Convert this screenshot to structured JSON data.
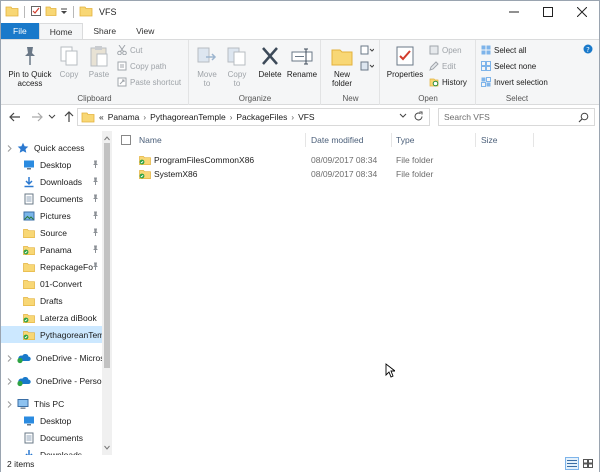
{
  "window": {
    "title": "VFS"
  },
  "ribbon": {
    "tabs": [
      {
        "label": "File"
      },
      {
        "label": "Home"
      },
      {
        "label": "Share"
      },
      {
        "label": "View"
      }
    ],
    "clipboard": {
      "label": "Clipboard",
      "pin": "Pin to Quick\naccess",
      "copy": "Copy",
      "paste": "Paste",
      "cut": "Cut",
      "copy_path": "Copy path",
      "paste_shortcut": "Paste shortcut"
    },
    "organize": {
      "label": "Organize",
      "move_to": "Move\nto",
      "copy_to": "Copy\nto",
      "delete": "Delete",
      "rename": "Rename"
    },
    "new": {
      "label": "New",
      "new_folder": "New\nfolder"
    },
    "open": {
      "label": "Open",
      "properties": "Properties",
      "open": "Open",
      "edit": "Edit",
      "history": "History"
    },
    "select": {
      "label": "Select",
      "select_all": "Select all",
      "select_none": "Select none",
      "invert": "Invert selection"
    }
  },
  "address": {
    "prefix": "«",
    "crumbs": [
      "Panama",
      "PythagoreanTemple",
      "PackageFiles",
      "VFS"
    ],
    "search_placeholder": "Search VFS"
  },
  "nav_pane": {
    "items": [
      {
        "label": "Quick access",
        "icon": "star-icon",
        "pinned": false
      },
      {
        "label": "Desktop",
        "icon": "desktop-icon",
        "pinned": true
      },
      {
        "label": "Downloads",
        "icon": "downloads-icon",
        "pinned": true
      },
      {
        "label": "Documents",
        "icon": "documents-icon",
        "pinned": true
      },
      {
        "label": "Pictures",
        "icon": "pictures-icon",
        "pinned": true
      },
      {
        "label": "Source",
        "icon": "folder-icon",
        "pinned": true
      },
      {
        "label": "Panama",
        "icon": "folder-green-icon",
        "pinned": true
      },
      {
        "label": "RepackageFo",
        "icon": "folder-icon",
        "pinned": true
      },
      {
        "label": "01-Convert",
        "icon": "folder-icon",
        "pinned": false
      },
      {
        "label": "Drafts",
        "icon": "folder-icon",
        "pinned": false
      },
      {
        "label": "Laterza diBook",
        "icon": "folder-green-icon",
        "pinned": false
      },
      {
        "label": "PythagoreanTem",
        "icon": "folder-green-icon",
        "pinned": false,
        "selected": true
      },
      {
        "label": "OneDrive - Micros",
        "icon": "onedrive-icon",
        "pinned": false
      },
      {
        "label": "OneDrive - Persor",
        "icon": "onedrive-icon",
        "pinned": false
      },
      {
        "label": "This PC",
        "icon": "computer-icon",
        "pinned": false
      },
      {
        "label": "Desktop",
        "icon": "desktop-icon",
        "pinned": false
      },
      {
        "label": "Documents",
        "icon": "documents-icon",
        "pinned": false
      },
      {
        "label": "Downloads",
        "icon": "downloads-icon",
        "pinned": false
      }
    ]
  },
  "file_list": {
    "columns": [
      "Name",
      "Date modified",
      "Type",
      "Size"
    ],
    "rows": [
      {
        "name": "ProgramFilesCommonX86",
        "date": "08/09/2017 08:34",
        "type": "File folder",
        "size": ""
      },
      {
        "name": "SystemX86",
        "date": "08/09/2017 08:34",
        "type": "File folder",
        "size": ""
      }
    ]
  },
  "status": {
    "count": "2 items"
  },
  "colors": {
    "accent": "#1979ca",
    "selection": "#cce8ff",
    "folder": "#f8d775",
    "folder_dark": "#e3b23c"
  }
}
